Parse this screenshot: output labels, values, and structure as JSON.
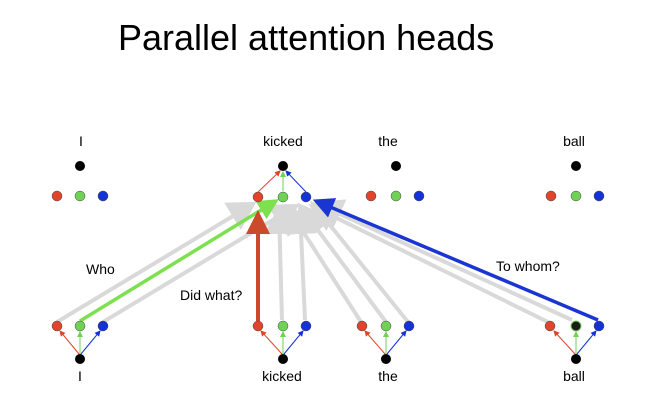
{
  "title": "Parallel attention heads",
  "top_words": [
    "I",
    "kicked",
    "the",
    "ball"
  ],
  "bottom_words": [
    "I",
    "kicked",
    "the",
    "ball"
  ],
  "head_labels": {
    "who": "Who",
    "did_what": "Did what?",
    "to_whom": "To whom?"
  },
  "colors": {
    "red_head": "#e0452b",
    "green_head": "#6fd255",
    "blue_head": "#1432d6",
    "token": "#000000",
    "gray_arrow": "#d9d9d9",
    "red_arrow": "#cc4a2c",
    "green_arrow": "#7ce04f",
    "blue_arrow": "#1a35d2"
  }
}
